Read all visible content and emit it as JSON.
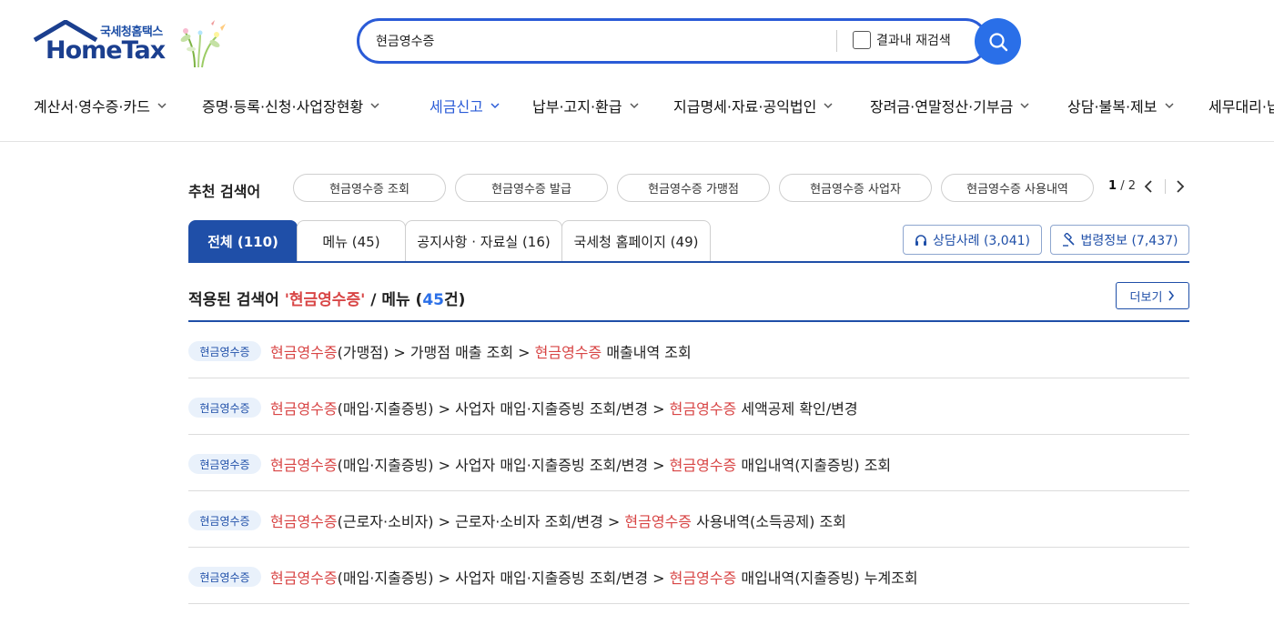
{
  "logo": {
    "small_text": "국세청홈택스",
    "brand_text": "HomeTax",
    "brand_color": "#1b3f8f"
  },
  "search": {
    "value": "현금영수증",
    "research_label": "결과내 재검색",
    "button_icon": "search-icon",
    "accent": "#2a5bd7"
  },
  "gnb": {
    "items": [
      {
        "label": "계산서·영수증·카드"
      },
      {
        "label": "증명·등록·신청·사업장현황"
      },
      {
        "label": "세금신고"
      },
      {
        "label": "납부·고지·환급"
      },
      {
        "label": "지급명세·자료·공익법인"
      },
      {
        "label": "장려금·연말정산·기부금"
      },
      {
        "label": "상담·불복·제보"
      },
      {
        "label": "세무대리·납"
      }
    ],
    "active_index": 2
  },
  "recommended": {
    "title": "추천 검색어",
    "chips": [
      "현금영수증 조회",
      "현금영수증 발급",
      "현금영수증 가맹점",
      "현금영수증 사업자",
      "현금영수증 사용내역"
    ],
    "page_current": "1",
    "page_total": "/ 2"
  },
  "tabs": [
    {
      "label": "전체 (110)",
      "active": true
    },
    {
      "label": "메뉴 (45)",
      "active": false
    },
    {
      "label": "공지사항 · 자료실 (16)",
      "active": false
    },
    {
      "label": "국세청 홈페이지 (49)",
      "active": false
    }
  ],
  "side_buttons": {
    "consult_label": "상담사례 (3,041)",
    "consult_icon": "headset-icon",
    "law_label": "법령정보 (7,437)",
    "law_icon": "gavel-icon"
  },
  "section": {
    "prefix": "적용된 검색어 ",
    "keyword": "'현금영수증'",
    "middle": " / 메뉴 (",
    "count": "45",
    "suffix": "건)",
    "more_label": "더보기"
  },
  "results": [
    {
      "badge": "현금영수증",
      "parts": [
        {
          "t": "현금영수증",
          "kw": true
        },
        {
          "t": "(가맹점) > 가맹점 매출 조회 > ",
          "kw": false
        },
        {
          "t": "현금영수증",
          "kw": true
        },
        {
          "t": " 매출내역 조회",
          "kw": false
        }
      ]
    },
    {
      "badge": "현금영수증",
      "parts": [
        {
          "t": "현금영수증",
          "kw": true
        },
        {
          "t": "(매입·지출증빙) > 사업자 매입·지출증빙 조회/변경 > ",
          "kw": false
        },
        {
          "t": "현금영수증",
          "kw": true
        },
        {
          "t": " 세액공제 확인/변경",
          "kw": false
        }
      ]
    },
    {
      "badge": "현금영수증",
      "parts": [
        {
          "t": "현금영수증",
          "kw": true
        },
        {
          "t": "(매입·지출증빙) > 사업자 매입·지출증빙 조회/변경 > ",
          "kw": false
        },
        {
          "t": "현금영수증",
          "kw": true
        },
        {
          "t": " 매입내역(지출증빙) 조회",
          "kw": false
        }
      ]
    },
    {
      "badge": "현금영수증",
      "parts": [
        {
          "t": "현금영수증",
          "kw": true
        },
        {
          "t": "(근로자·소비자) > 근로자·소비자 조회/변경 > ",
          "kw": false
        },
        {
          "t": "현금영수증",
          "kw": true
        },
        {
          "t": " 사용내역(소득공제) 조회",
          "kw": false
        }
      ]
    },
    {
      "badge": "현금영수증",
      "parts": [
        {
          "t": "현금영수증",
          "kw": true
        },
        {
          "t": "(매입·지출증빙) > 사업자 매입·지출증빙 조회/변경 > ",
          "kw": false
        },
        {
          "t": "현금영수증",
          "kw": true
        },
        {
          "t": " 매입내역(지출증빙) 누계조회",
          "kw": false
        }
      ]
    }
  ],
  "colors": {
    "keyword": "#d84545",
    "primary": "#1f4fa8",
    "badge_bg": "#e9f1fb"
  }
}
